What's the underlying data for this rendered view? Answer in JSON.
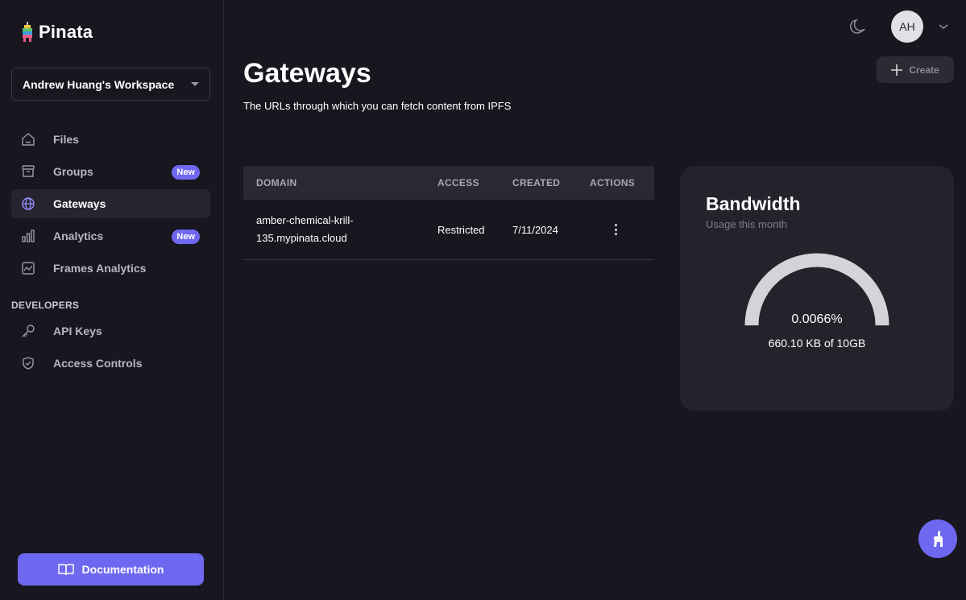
{
  "brand": {
    "name": "Pinata"
  },
  "workspace": {
    "name": "Andrew Huang's Workspace"
  },
  "nav": {
    "items": [
      {
        "label": "Files",
        "icon": "home-icon"
      },
      {
        "label": "Groups",
        "icon": "archive-icon",
        "badge": "New"
      },
      {
        "label": "Gateways",
        "icon": "globe-icon",
        "active": true
      },
      {
        "label": "Analytics",
        "icon": "bar-chart-icon",
        "badge": "New"
      },
      {
        "label": "Frames Analytics",
        "icon": "line-chart-icon"
      }
    ],
    "developers_label": "DEVELOPERS",
    "developers": [
      {
        "label": "API Keys",
        "icon": "key-icon"
      },
      {
        "label": "Access Controls",
        "icon": "shield-icon"
      }
    ],
    "docs_label": "Documentation"
  },
  "header": {
    "avatar_initials": "AH",
    "create_label": "Create"
  },
  "page": {
    "title": "Gateways",
    "subtitle": "The URLs through which you can fetch content from IPFS"
  },
  "table": {
    "columns": [
      "DOMAIN",
      "ACCESS",
      "CREATED",
      "ACTIONS"
    ],
    "rows": [
      {
        "domain_line1": "amber-chemical-krill-",
        "domain_line2": "135.mypinata.cloud",
        "access": "Restricted",
        "created": "7/11/2024"
      }
    ]
  },
  "bandwidth": {
    "title": "Bandwidth",
    "subtitle": "Usage this month",
    "percent_label": "0.0066%",
    "percent_value": 0.0066,
    "usage_label": "660.10 KB of 10GB"
  },
  "colors": {
    "accent": "#6e68f0",
    "background": "#18161f",
    "card": "#24222b"
  }
}
